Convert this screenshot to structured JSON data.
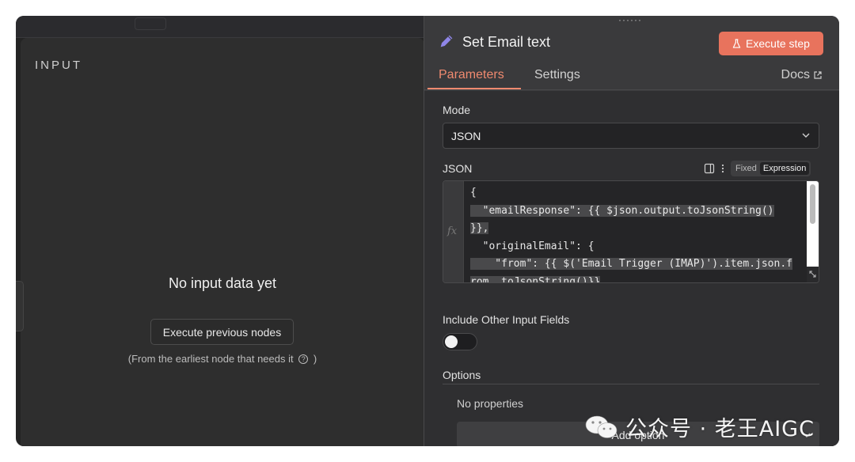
{
  "input_panel": {
    "title": "INPUT",
    "empty_message": "No input data yet",
    "execute_previous_label": "Execute previous nodes",
    "hint_prefix": "(From the earliest node that needs it",
    "hint_suffix": ")"
  },
  "node_panel": {
    "title": "Set Email text",
    "execute_step_label": "Execute step",
    "tabs": [
      {
        "label": "Parameters",
        "active": true
      },
      {
        "label": "Settings",
        "active": false
      }
    ],
    "docs_label": "Docs",
    "accent_color": "#e8735d"
  },
  "parameters": {
    "mode_label": "Mode",
    "mode_value": "JSON",
    "json_label": "JSON",
    "json_modes": [
      "Fixed",
      "Expression"
    ],
    "json_mode_selected": "Expression",
    "fx_marker": "fx",
    "code_lines": [
      "{",
      "  \"emailResponse\": {{ $json.output.toJsonString()",
      "}},",
      "  \"originalEmail\": {",
      "    \"from\": {{ $('Email Trigger (IMAP)').item.json.f",
      "rom..toJsonString()}}"
    ],
    "include_other_label": "Include Other Input Fields",
    "include_other_enabled": false,
    "options_label": "Options",
    "no_properties": "No properties",
    "add_option_label": "Add option"
  },
  "watermark": {
    "text": "公众号 · 老王AIGC"
  }
}
